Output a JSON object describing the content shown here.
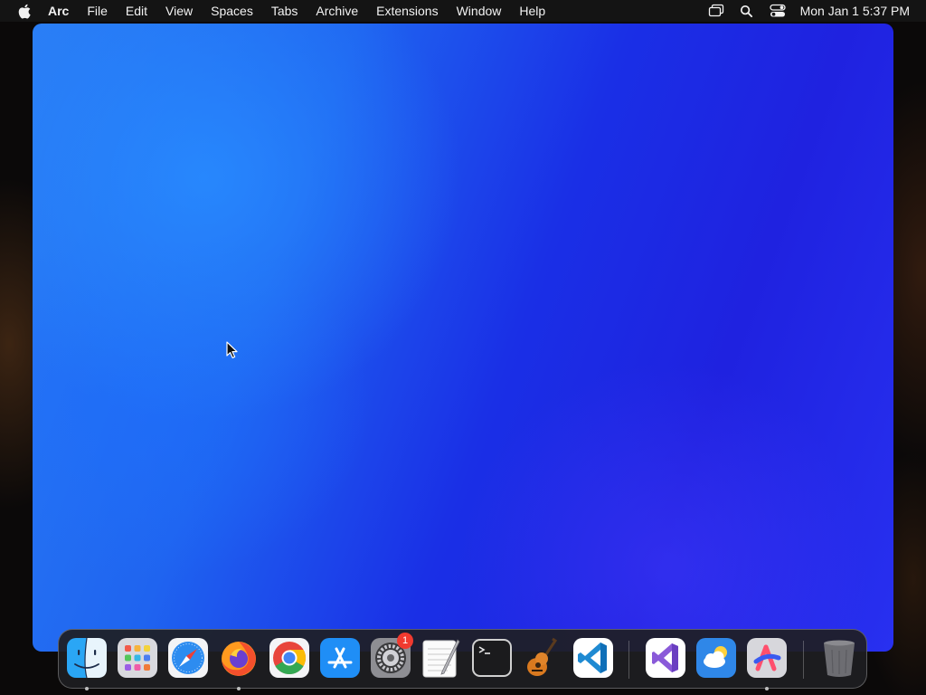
{
  "menubar": {
    "app_name": "Arc",
    "items": [
      "File",
      "Edit",
      "View",
      "Spaces",
      "Tabs",
      "Archive",
      "Extensions",
      "Window",
      "Help"
    ],
    "clock": "Mon Jan 1  5:37 PM",
    "status_icons": [
      "screen-mirroring-icon",
      "spotlight-search-icon",
      "control-center-icon"
    ]
  },
  "dock": {
    "apps": [
      {
        "name": "Finder",
        "icon": "finder-icon",
        "running": true
      },
      {
        "name": "Launchpad",
        "icon": "launchpad-icon",
        "running": false
      },
      {
        "name": "Safari",
        "icon": "safari-icon",
        "running": false
      },
      {
        "name": "Firefox",
        "icon": "firefox-icon",
        "running": true
      },
      {
        "name": "Google Chrome",
        "icon": "chrome-icon",
        "running": false
      },
      {
        "name": "App Store",
        "icon": "app-store-icon",
        "running": false
      },
      {
        "name": "System Settings",
        "icon": "system-settings-icon",
        "running": false,
        "badge": "1"
      },
      {
        "name": "TextEdit",
        "icon": "textedit-icon",
        "running": false
      },
      {
        "name": "Terminal",
        "icon": "terminal-icon",
        "running": false
      },
      {
        "name": "GarageBand",
        "icon": "garageband-icon",
        "running": false
      },
      {
        "name": "Visual Studio Code",
        "icon": "vscode-icon",
        "running": false
      },
      {
        "name": "Visual Studio",
        "icon": "visual-studio-icon",
        "running": false
      },
      {
        "name": "Weather",
        "icon": "weather-icon",
        "running": false
      },
      {
        "name": "Arc",
        "icon": "arc-browser-icon",
        "running": true
      },
      {
        "name": "Trash",
        "icon": "trash-icon",
        "running": false
      }
    ]
  },
  "colors": {
    "menubar_bg": "#141414",
    "window_blue": "#1f3cf0",
    "badge_red": "#f03a2f"
  }
}
